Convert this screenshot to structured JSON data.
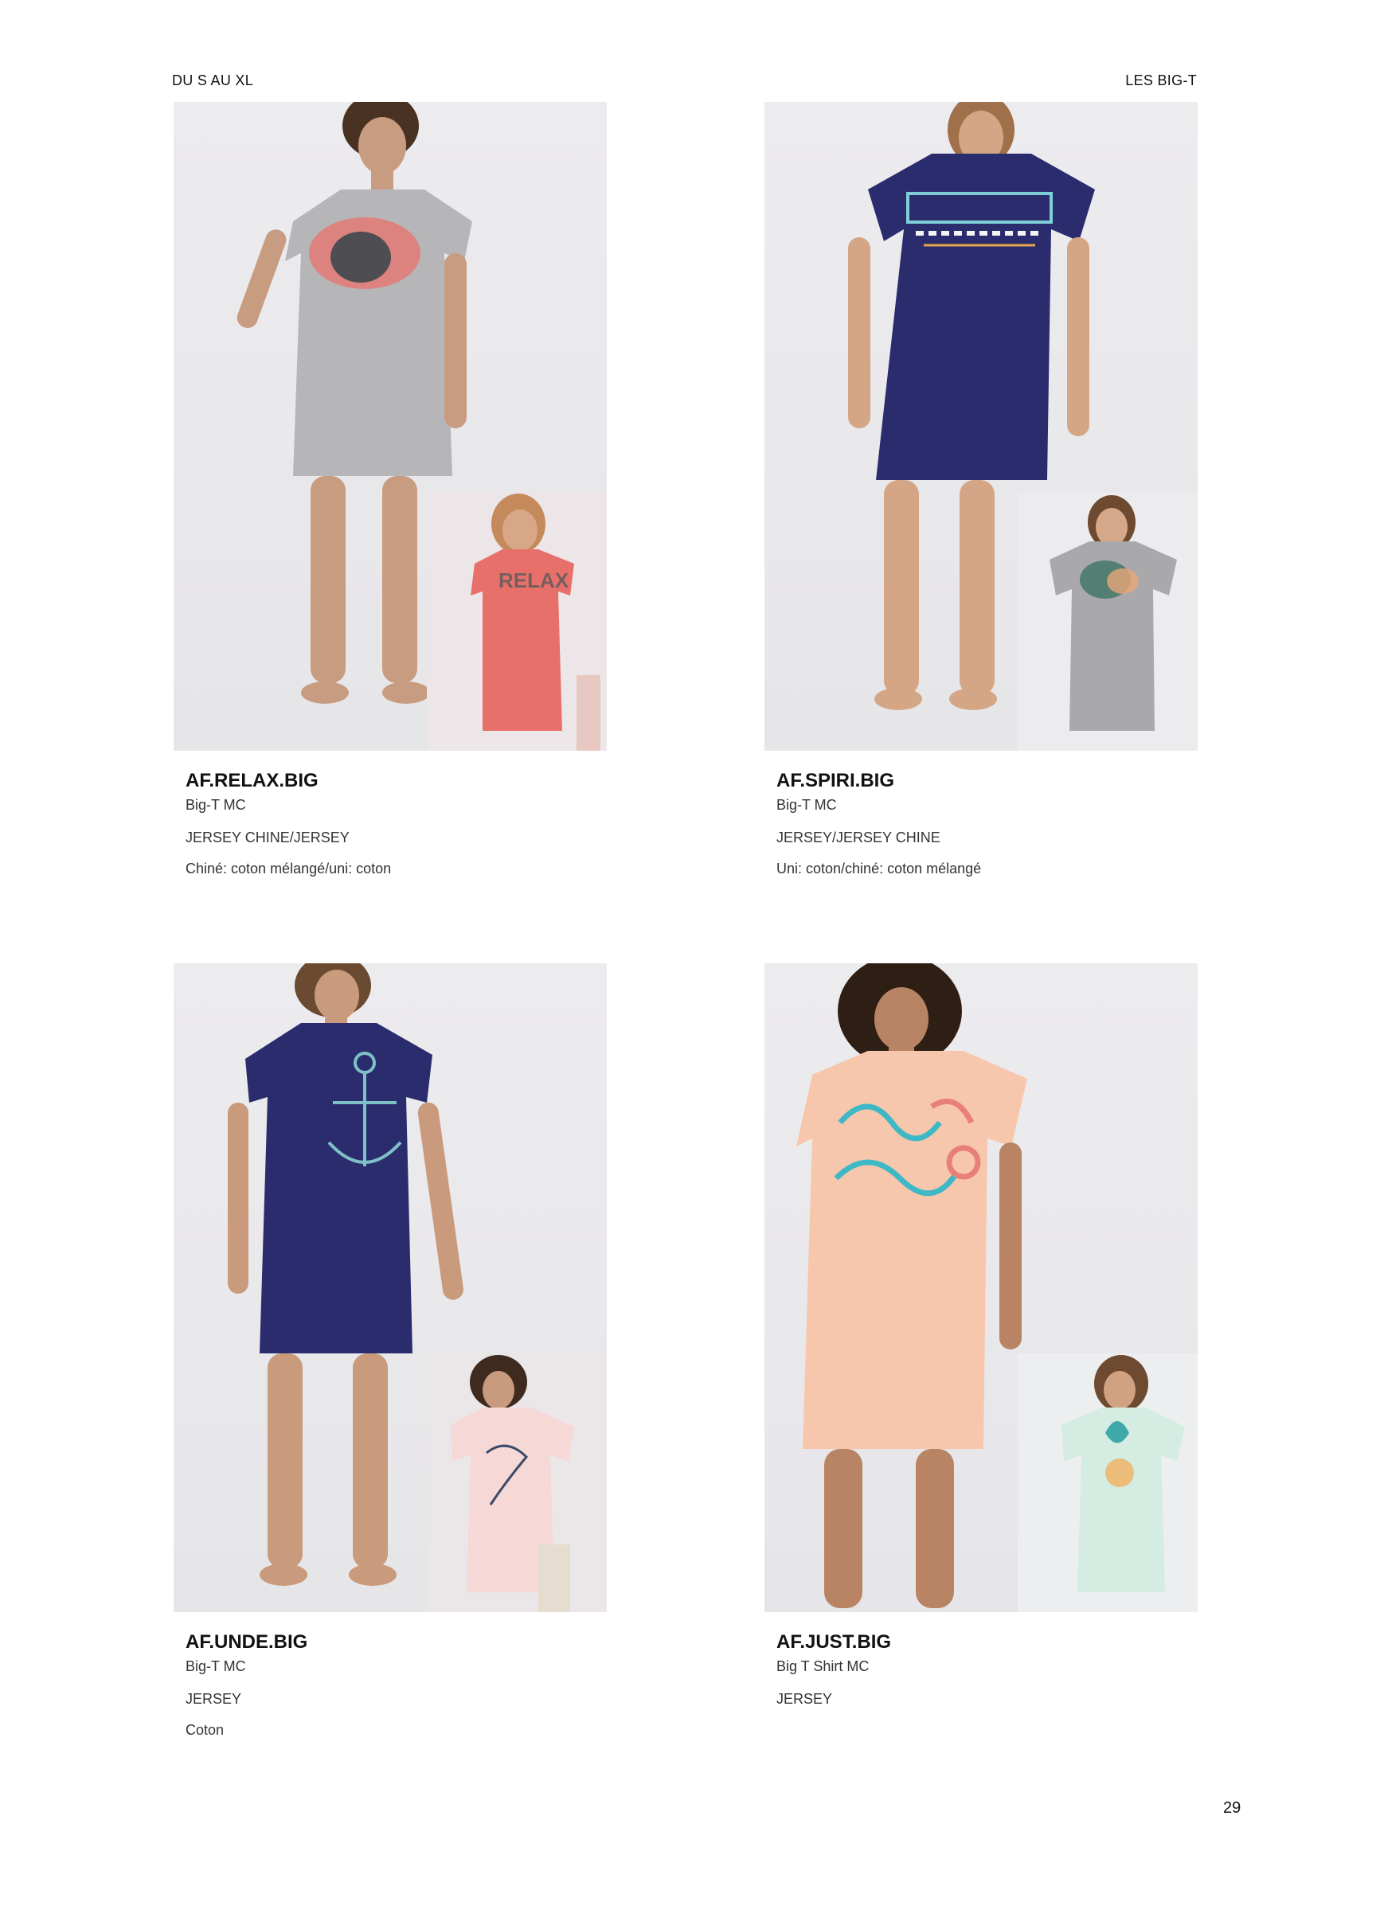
{
  "header": {
    "left": "DU S AU XL",
    "right": "LES BIG-T"
  },
  "page_number": "29",
  "products": [
    {
      "ref": "AF.RELAX.BIG",
      "type": "Big-T MC",
      "fabric": "JERSEY CHINE/JERSEY",
      "composition": "Chiné: coton mélangé/uni: coton",
      "main_color": "#b6b6b8",
      "inset_color": "#e8706a",
      "inset_bg": "#ece6e8"
    },
    {
      "ref": "AF.SPIRI.BIG",
      "type": "Big-T MC",
      "fabric": "JERSEY/JERSEY CHINE",
      "composition": "Uni: coton/chiné: coton mélangé",
      "main_color": "#2a2c6e",
      "inset_color": "#a9a9ab",
      "inset_bg": "#ececee"
    },
    {
      "ref": "AF.UNDE.BIG",
      "type": "Big-T MC",
      "fabric": "JERSEY",
      "composition": "Coton",
      "main_color": "#2a2c6e",
      "inset_color": "#f6d8d6",
      "inset_bg": "#ebe7e8"
    },
    {
      "ref": "AF.JUST.BIG",
      "type": "Big T Shirt MC",
      "fabric": "JERSEY",
      "composition": "",
      "main_color": "#f7c7ad",
      "inset_color": "#d4ece2",
      "inset_bg": "#eceef0"
    }
  ]
}
